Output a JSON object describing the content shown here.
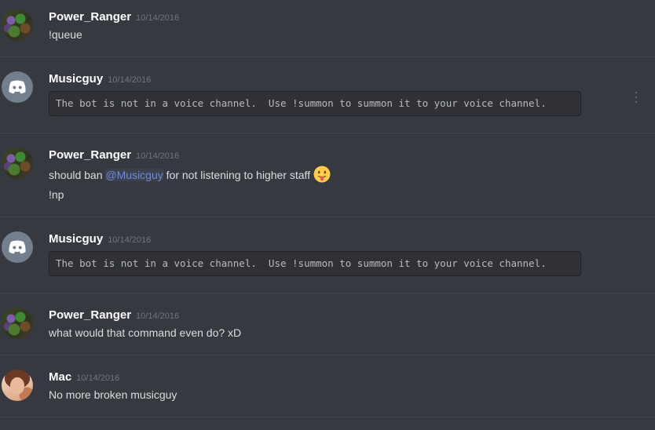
{
  "messages": [
    {
      "author": "Power_Ranger",
      "timestamp": "10/14/2016",
      "avatar": "power-ranger-avatar",
      "lines": [
        "!queue"
      ]
    },
    {
      "author": "Musicguy",
      "timestamp": "10/14/2016",
      "avatar": "discord-default-avatar",
      "code": "The bot is not in a voice channel.  Use !summon to summon it to your voice channel."
    },
    {
      "author": "Power_Ranger",
      "timestamp": "10/14/2016",
      "avatar": "power-ranger-avatar",
      "line1_pre": "should ban ",
      "line1_mention": "@Musicguy",
      "line1_post": " for not listening to higher staff",
      "line1_emoji": "stuck-out-tongue-emoji",
      "line2": "!np"
    },
    {
      "author": "Musicguy",
      "timestamp": "10/14/2016",
      "avatar": "discord-default-avatar",
      "code": "The bot is not in a voice channel.  Use !summon to summon it to your voice channel."
    },
    {
      "author": "Power_Ranger",
      "timestamp": "10/14/2016",
      "avatar": "power-ranger-avatar",
      "lines": [
        "what would that command even do? xD"
      ]
    },
    {
      "author": "Mac",
      "timestamp": "10/14/2016",
      "avatar": "mac-avatar",
      "lines": [
        "No more broken musicguy"
      ]
    }
  ],
  "colors": {
    "background": "#36393f",
    "mention": "#7289da",
    "username": "#ffffff",
    "text": "#dcddde",
    "timestamp": "#72767d"
  },
  "icons": {
    "more": "more-options-icon"
  }
}
